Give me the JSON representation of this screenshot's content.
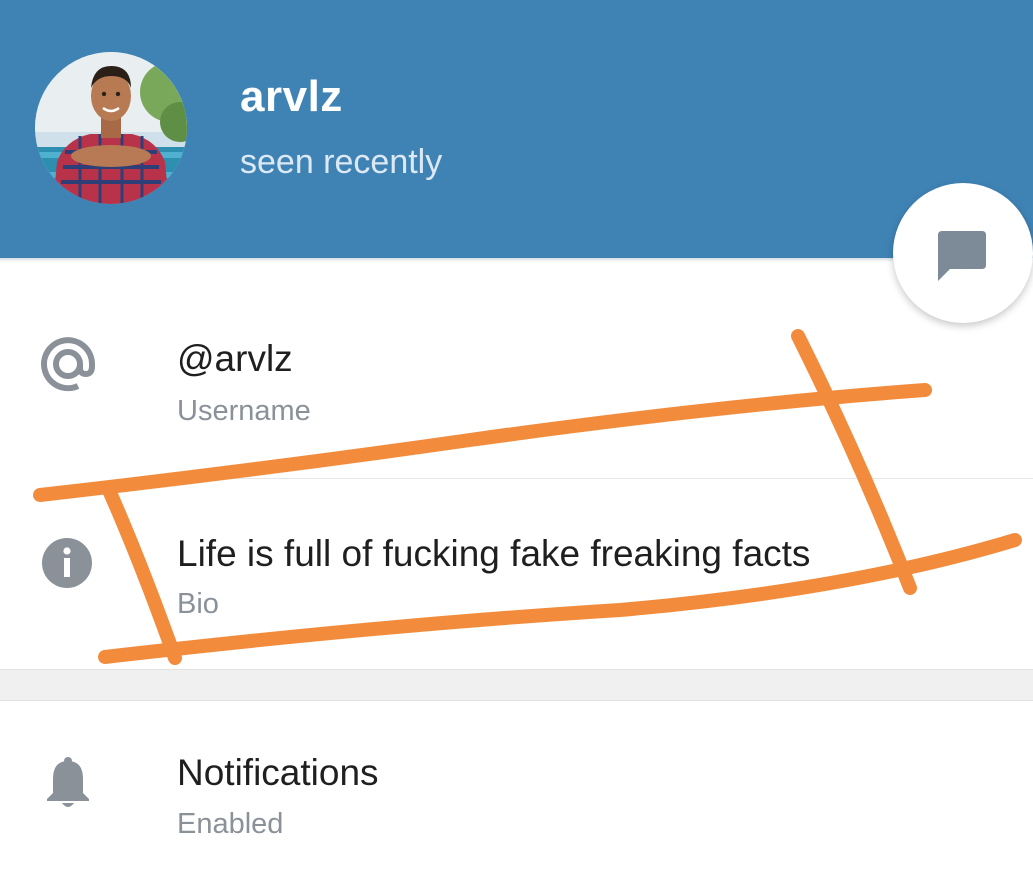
{
  "header": {
    "name": "arvlz",
    "status": "seen recently",
    "avatar_icon": "user-avatar-photo",
    "background_color": "#3f83b5"
  },
  "fab": {
    "icon": "message-bubble-icon"
  },
  "info_rows": [
    {
      "icon": "at-sign-icon",
      "title": "@arvlz",
      "subtitle": "Username"
    },
    {
      "icon": "info-icon",
      "title": "Life is full of fucking fake freaking facts",
      "subtitle": "Bio"
    }
  ],
  "settings_rows": [
    {
      "icon": "bell-icon",
      "title": "Notifications",
      "subtitle": "Enabled"
    }
  ],
  "annotation": {
    "color": "#f28c3c"
  }
}
